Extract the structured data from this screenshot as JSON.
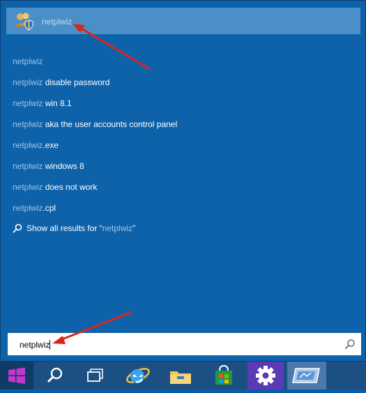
{
  "search": {
    "top_result": {
      "label": "netplwiz",
      "icon": "user-accounts-icon"
    },
    "suggestions": [
      {
        "query": "netplwiz",
        "rest": ""
      },
      {
        "query": "netplwiz",
        "rest": " disable password"
      },
      {
        "query": "netplwiz",
        "rest": " win 8.1"
      },
      {
        "query": "netplwiz",
        "rest": " aka the user accounts control panel"
      },
      {
        "query": "netplwiz",
        "rest": ".exe"
      },
      {
        "query": "netplwiz",
        "rest": " windows 8"
      },
      {
        "query": "netplwiz",
        "rest": " does not work"
      },
      {
        "query": "netplwiz",
        "rest": ".cpl"
      }
    ],
    "show_all": {
      "prefix": "Show all results for “",
      "query": "netplwiz",
      "suffix": "”"
    },
    "input_value": "netplwiz"
  },
  "taskbar": {
    "items": [
      "start-button",
      "search-button",
      "task-view-button",
      "internet-explorer",
      "file-explorer",
      "store",
      "settings",
      "remote-desktop"
    ]
  },
  "colors": {
    "panel": "#0e62aa",
    "selected": "#4a8fc8",
    "taskbar": "#1c4f84",
    "annotation": "#d9261c"
  }
}
